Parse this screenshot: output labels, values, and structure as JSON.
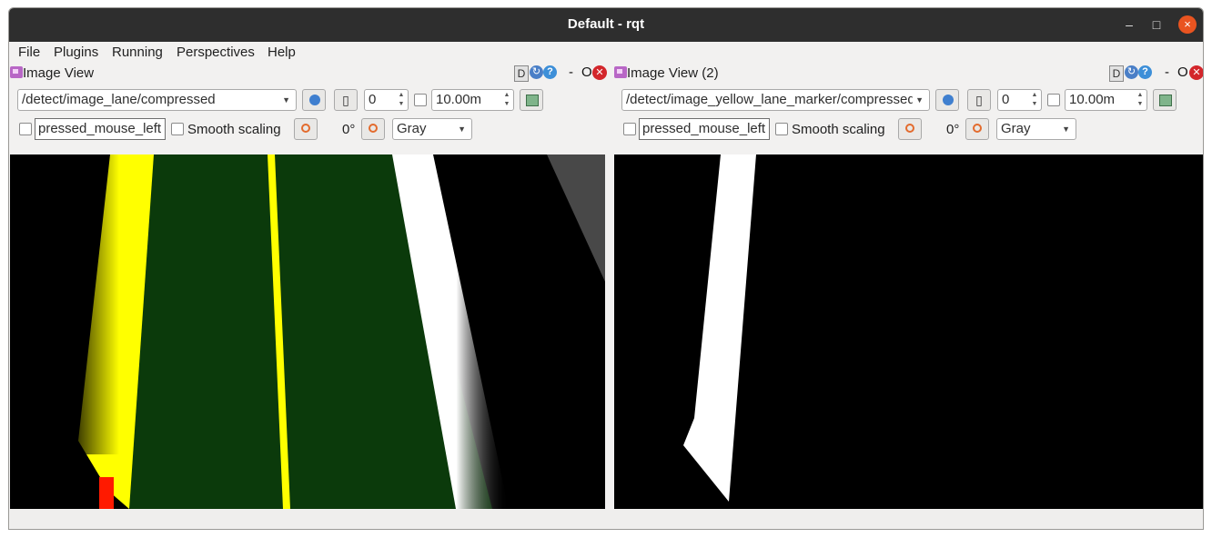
{
  "window": {
    "title": "Default - rqt"
  },
  "window_controls": {
    "minimize": "–",
    "maximize": "□",
    "close": "×"
  },
  "menu": [
    "File",
    "Plugins",
    "Running",
    "Perspectives",
    "Help"
  ],
  "panels": [
    {
      "title": "Image View",
      "header_buttons": {
        "d": "D",
        "dash": "-",
        "o": "O"
      },
      "topic": "/detect/image_lane/compressed",
      "spin_value": "0",
      "time_value": "10.00m",
      "mouse_topic": "pressed_mouse_left",
      "smooth_label": "Smooth scaling",
      "rotation": "0°",
      "colormap": "Gray"
    },
    {
      "title": "Image View (2)",
      "header_buttons": {
        "d": "D",
        "dash": "-",
        "o": "O"
      },
      "topic": "/detect/image_yellow_lane_marker/compressed",
      "spin_value": "0",
      "time_value": "10.00m",
      "mouse_topic": "pressed_mouse_left",
      "smooth_label": "Smooth scaling",
      "rotation": "0°",
      "colormap": "Gray"
    }
  ],
  "colors": {
    "titlebar": "#2e2e2e",
    "close": "#e95420",
    "lane_green": "#0b3a0b",
    "yellow": "#ffff00"
  }
}
